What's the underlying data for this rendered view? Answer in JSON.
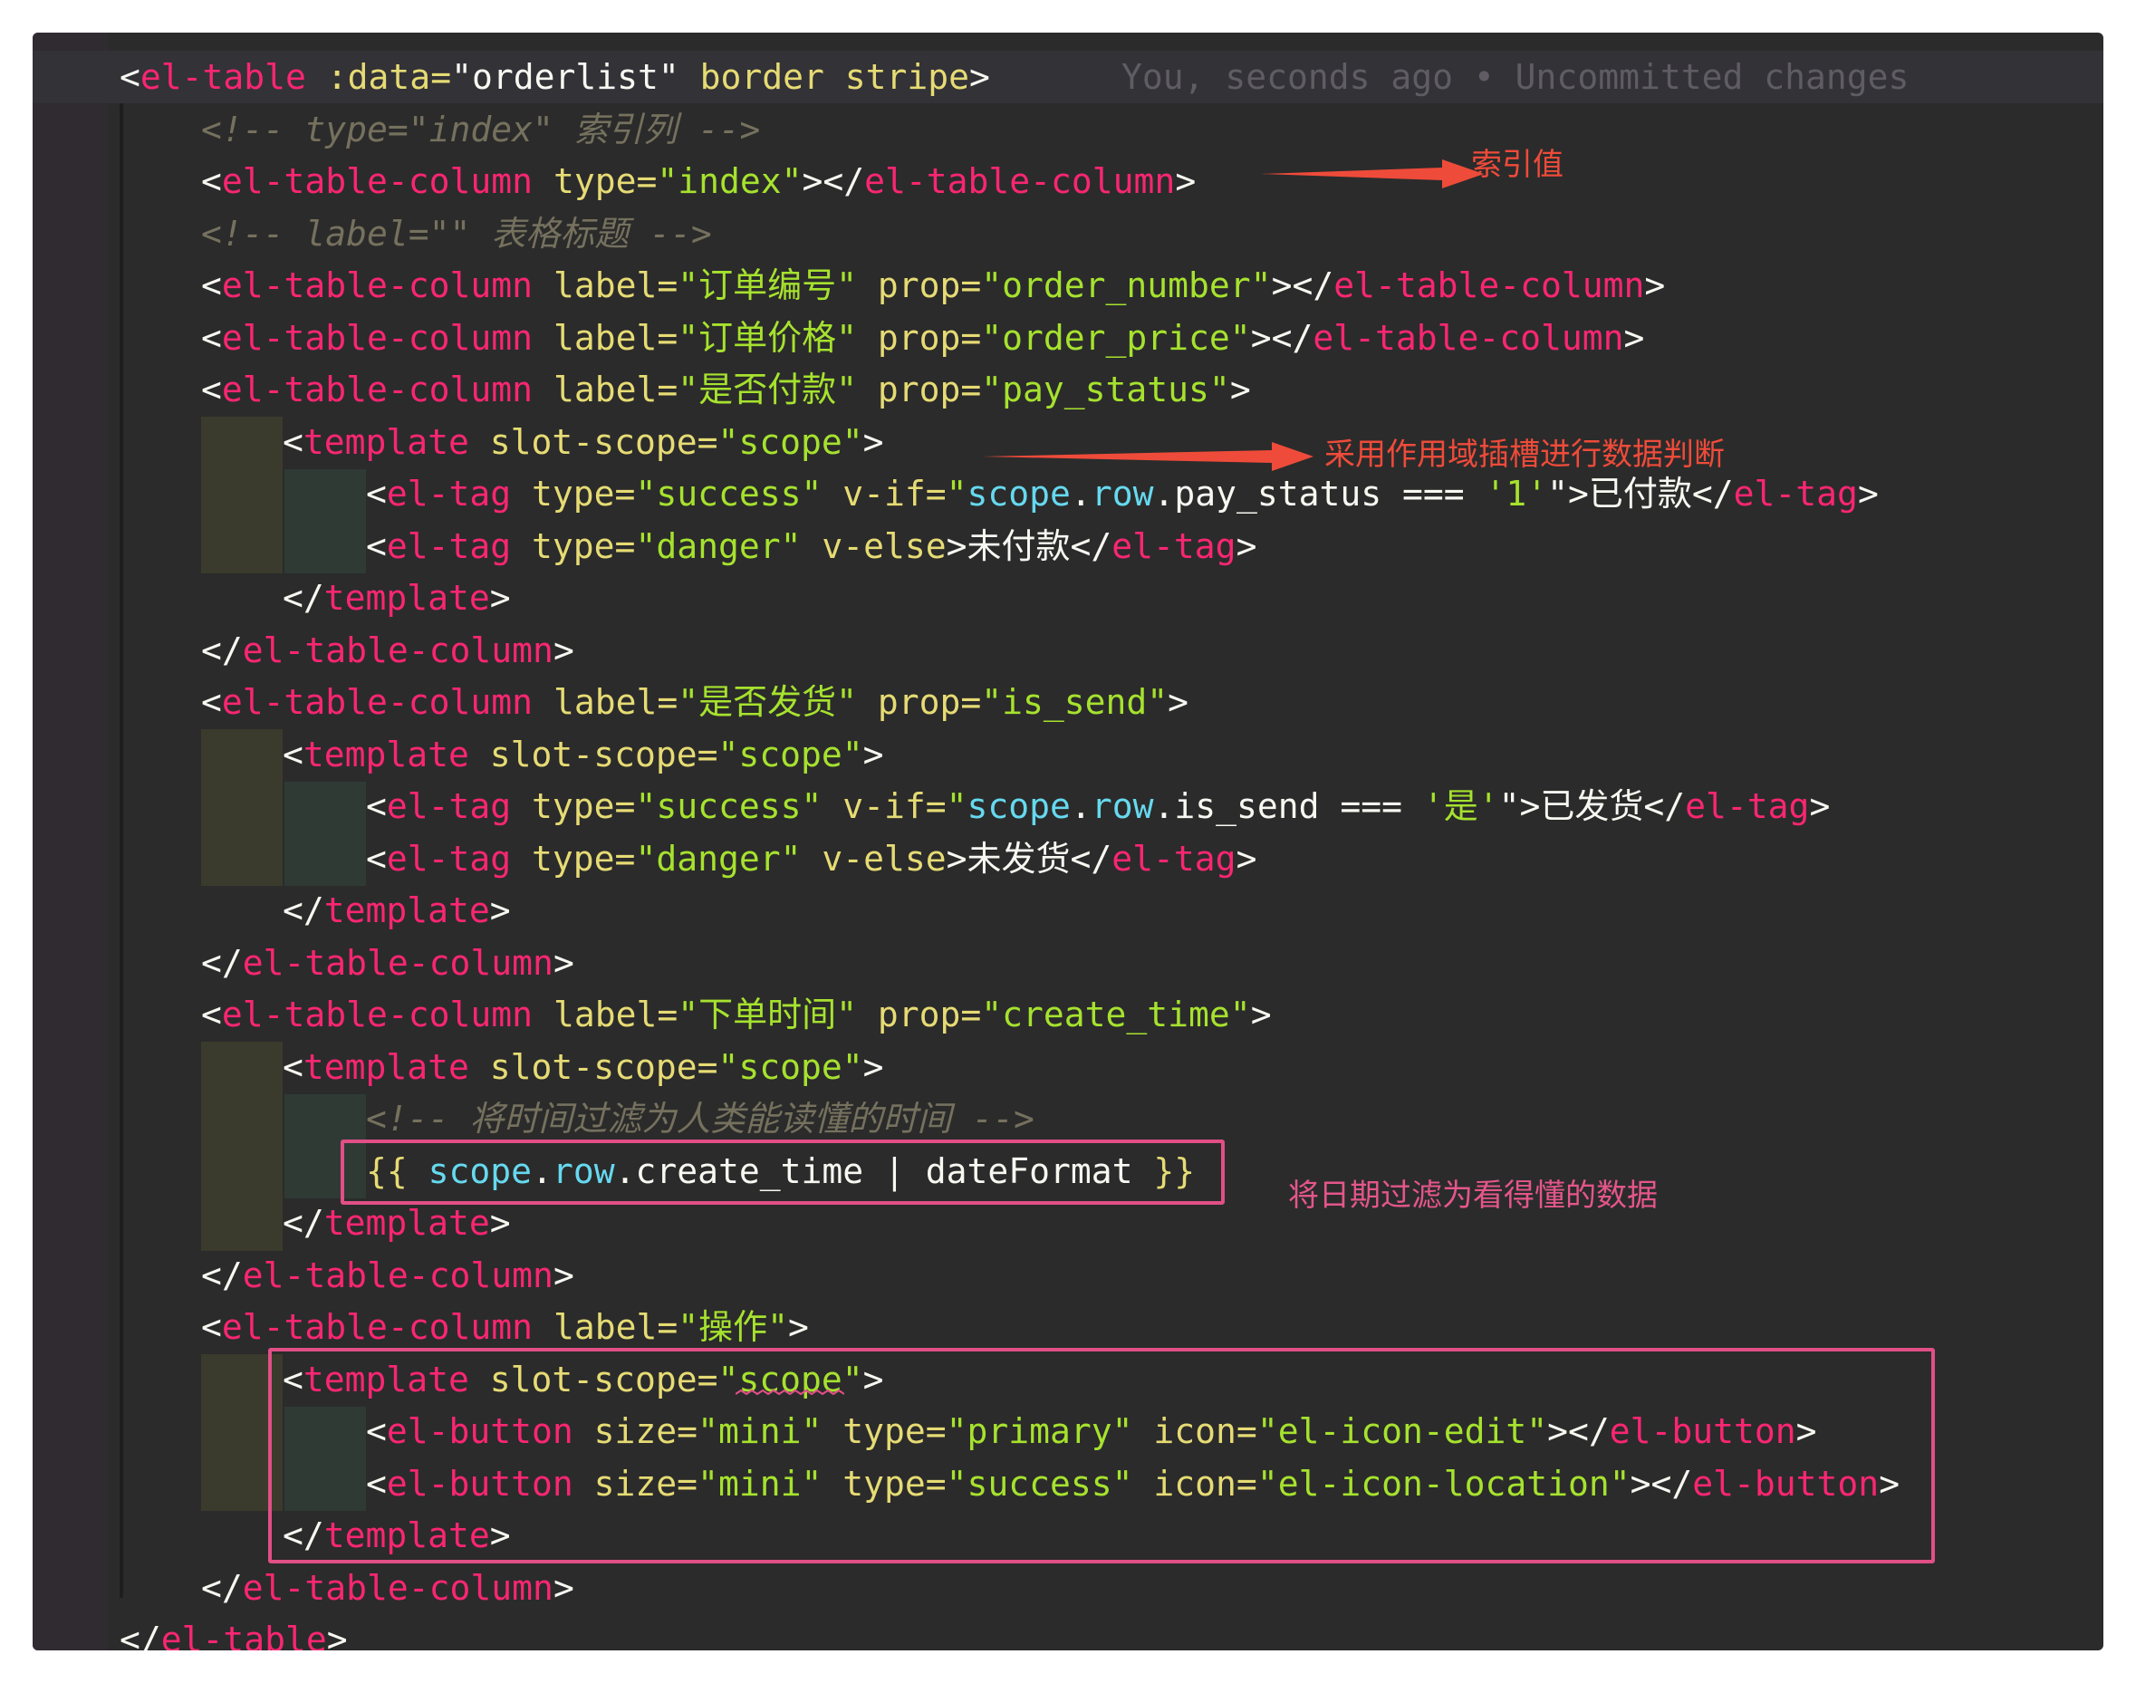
{
  "editor": {
    "blame": "You, seconds ago • Uncommitted changes",
    "lines": [
      [
        [
          "<",
          "br"
        ],
        [
          "el-table",
          "tag"
        ],
        [
          " :data=",
          "attr"
        ],
        [
          "\"orderlist\"",
          "mu"
        ],
        [
          " border stripe",
          "attr"
        ],
        [
          ">",
          "br"
        ]
      ],
      [
        [
          "<!-- type=\"index\" 索引列 -->",
          "cm"
        ]
      ],
      [
        [
          "<",
          "br"
        ],
        [
          "el-table-column",
          "tag"
        ],
        [
          " type=",
          "attr"
        ],
        [
          "\"index\"",
          "val"
        ],
        [
          "></",
          "br"
        ],
        [
          "el-table-column",
          "tag"
        ],
        [
          ">",
          "br"
        ]
      ],
      [
        [
          "<!-- label=\"\" 表格标题 -->",
          "cm"
        ]
      ],
      [
        [
          "<",
          "br"
        ],
        [
          "el-table-column",
          "tag"
        ],
        [
          " label=",
          "attr"
        ],
        [
          "\"订单编号\"",
          "val"
        ],
        [
          " prop=",
          "attr"
        ],
        [
          "\"order_number\"",
          "val"
        ],
        [
          "></",
          "br"
        ],
        [
          "el-table-column",
          "tag"
        ],
        [
          ">",
          "br"
        ]
      ],
      [
        [
          "<",
          "br"
        ],
        [
          "el-table-column",
          "tag"
        ],
        [
          " label=",
          "attr"
        ],
        [
          "\"订单价格\"",
          "val"
        ],
        [
          " prop=",
          "attr"
        ],
        [
          "\"order_price\"",
          "val"
        ],
        [
          "></",
          "br"
        ],
        [
          "el-table-column",
          "tag"
        ],
        [
          ">",
          "br"
        ]
      ],
      [
        [
          "<",
          "br"
        ],
        [
          "el-table-column",
          "tag"
        ],
        [
          " label=",
          "attr"
        ],
        [
          "\"是否付款\"",
          "val"
        ],
        [
          " prop=",
          "attr"
        ],
        [
          "\"pay_status\"",
          "val"
        ],
        [
          ">",
          "br"
        ]
      ],
      [
        [
          "<",
          "br"
        ],
        [
          "template",
          "tag"
        ],
        [
          " slot-scope=",
          "attr"
        ],
        [
          "\"scope\"",
          "val"
        ],
        [
          ">",
          "br"
        ]
      ],
      [
        [
          "<",
          "br"
        ],
        [
          "el-tag",
          "tag"
        ],
        [
          " type=",
          "attr"
        ],
        [
          "\"success\"",
          "val"
        ],
        [
          " v-if=",
          "attr"
        ],
        [
          "\"",
          "val"
        ],
        [
          "scope",
          "js"
        ],
        [
          ".",
          "mu"
        ],
        [
          "row",
          "js"
        ],
        [
          ".pay_status === ",
          "mu"
        ],
        [
          "'1'",
          "val"
        ],
        [
          "\">已付款</",
          "br"
        ],
        [
          "el-tag",
          "tag"
        ],
        [
          ">",
          "br"
        ]
      ],
      [
        [
          "<",
          "br"
        ],
        [
          "el-tag",
          "tag"
        ],
        [
          " type=",
          "attr"
        ],
        [
          "\"danger\"",
          "val"
        ],
        [
          " v-else",
          "attr"
        ],
        [
          ">未付款</",
          "br"
        ],
        [
          "el-tag",
          "tag"
        ],
        [
          ">",
          "br"
        ]
      ],
      [
        [
          "</",
          "br"
        ],
        [
          "template",
          "tag"
        ],
        [
          ">",
          "br"
        ]
      ],
      [
        [
          "</",
          "br"
        ],
        [
          "el-table-column",
          "tag"
        ],
        [
          ">",
          "br"
        ]
      ],
      [
        [
          "<",
          "br"
        ],
        [
          "el-table-column",
          "tag"
        ],
        [
          " label=",
          "attr"
        ],
        [
          "\"是否发货\"",
          "val"
        ],
        [
          " prop=",
          "attr"
        ],
        [
          "\"is_send\"",
          "val"
        ],
        [
          ">",
          "br"
        ]
      ],
      [
        [
          "<",
          "br"
        ],
        [
          "template",
          "tag"
        ],
        [
          " slot-scope=",
          "attr"
        ],
        [
          "\"scope\"",
          "val"
        ],
        [
          ">",
          "br"
        ]
      ],
      [
        [
          "<",
          "br"
        ],
        [
          "el-tag",
          "tag"
        ],
        [
          " type=",
          "attr"
        ],
        [
          "\"success\"",
          "val"
        ],
        [
          " v-if=",
          "attr"
        ],
        [
          "\"",
          "val"
        ],
        [
          "scope",
          "js"
        ],
        [
          ".",
          "mu"
        ],
        [
          "row",
          "js"
        ],
        [
          ".is_send === ",
          "mu"
        ],
        [
          "'是'",
          "val"
        ],
        [
          "\">已发货</",
          "br"
        ],
        [
          "el-tag",
          "tag"
        ],
        [
          ">",
          "br"
        ]
      ],
      [
        [
          "<",
          "br"
        ],
        [
          "el-tag",
          "tag"
        ],
        [
          " type=",
          "attr"
        ],
        [
          "\"danger\"",
          "val"
        ],
        [
          " v-else",
          "attr"
        ],
        [
          ">未发货</",
          "br"
        ],
        [
          "el-tag",
          "tag"
        ],
        [
          ">",
          "br"
        ]
      ],
      [
        [
          "</",
          "br"
        ],
        [
          "template",
          "tag"
        ],
        [
          ">",
          "br"
        ]
      ],
      [
        [
          "</",
          "br"
        ],
        [
          "el-table-column",
          "tag"
        ],
        [
          ">",
          "br"
        ]
      ],
      [
        [
          "<",
          "br"
        ],
        [
          "el-table-column",
          "tag"
        ],
        [
          " label=",
          "attr"
        ],
        [
          "\"下单时间\"",
          "val"
        ],
        [
          " prop=",
          "attr"
        ],
        [
          "\"create_time\"",
          "val"
        ],
        [
          ">",
          "br"
        ]
      ],
      [
        [
          "<",
          "br"
        ],
        [
          "template",
          "tag"
        ],
        [
          " slot-scope=",
          "attr"
        ],
        [
          "\"scope\"",
          "val"
        ],
        [
          ">",
          "br"
        ]
      ],
      [
        [
          "<!-- 将时间过滤为人类能读懂的时间 -->",
          "cm"
        ]
      ],
      [
        [
          "{{",
          "attr"
        ],
        [
          " scope",
          "js"
        ],
        [
          ".",
          "mu"
        ],
        [
          "row",
          "js"
        ],
        [
          ".create_time | dateFormat ",
          "mu"
        ],
        [
          "}}",
          "attr"
        ]
      ],
      [
        [
          "</",
          "br"
        ],
        [
          "template",
          "tag"
        ],
        [
          ">",
          "br"
        ]
      ],
      [
        [
          "</",
          "br"
        ],
        [
          "el-table-column",
          "tag"
        ],
        [
          ">",
          "br"
        ]
      ],
      [
        [
          "<",
          "br"
        ],
        [
          "el-table-column",
          "tag"
        ],
        [
          " label=",
          "attr"
        ],
        [
          "\"操作\"",
          "val"
        ],
        [
          ">",
          "br"
        ]
      ],
      [
        [
          "<",
          "br"
        ],
        [
          "template",
          "tag"
        ],
        [
          " slot-scope=",
          "attr"
        ],
        [
          "\"scope\"",
          "val"
        ],
        [
          ">",
          "br"
        ]
      ],
      [
        [
          "<",
          "br"
        ],
        [
          "el-button",
          "tag"
        ],
        [
          " size=",
          "attr"
        ],
        [
          "\"mini\"",
          "val"
        ],
        [
          " type=",
          "attr"
        ],
        [
          "\"primary\"",
          "val"
        ],
        [
          " icon=",
          "attr"
        ],
        [
          "\"el-icon-edit\"",
          "val"
        ],
        [
          "></",
          "br"
        ],
        [
          "el-button",
          "tag"
        ],
        [
          ">",
          "br"
        ]
      ],
      [
        [
          "<",
          "br"
        ],
        [
          "el-button",
          "tag"
        ],
        [
          " size=",
          "attr"
        ],
        [
          "\"mini\"",
          "val"
        ],
        [
          " type=",
          "attr"
        ],
        [
          "\"success\"",
          "val"
        ],
        [
          " icon=",
          "attr"
        ],
        [
          "\"el-icon-location\"",
          "val"
        ],
        [
          "></",
          "br"
        ],
        [
          "el-button",
          "tag"
        ],
        [
          ">",
          "br"
        ]
      ],
      [
        [
          "</",
          "br"
        ],
        [
          "template",
          "tag"
        ],
        [
          ">",
          "br"
        ]
      ],
      [
        [
          "</",
          "br"
        ],
        [
          "el-table-column",
          "tag"
        ],
        [
          ">",
          "br"
        ]
      ],
      [
        [
          "</",
          "br"
        ],
        [
          "el-table",
          "tag"
        ],
        [
          ">",
          "br"
        ]
      ]
    ]
  },
  "annotations": {
    "index_value": "索引值",
    "scoped_slot": "采用作用域插槽进行数据判断",
    "date_filter": "将日期过滤为看得懂的数据"
  },
  "colors": {
    "background": "#2b2b2b",
    "tag": "#f92672",
    "attribute": "#e6db74",
    "string": "#a6e22e",
    "comment": "#75715e",
    "annotation_red": "#ef4b3a",
    "annotation_pink": "#e14f86"
  }
}
